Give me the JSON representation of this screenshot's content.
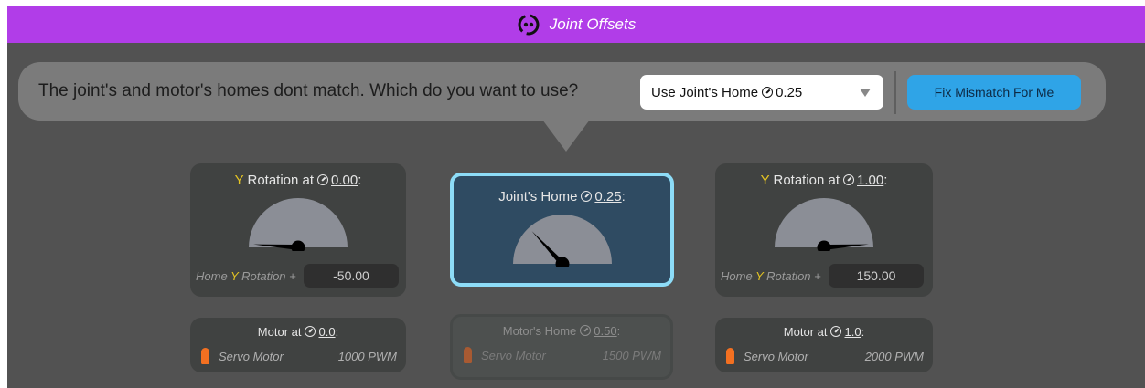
{
  "header": {
    "title": "Joint Offsets",
    "icon": "joint-icon"
  },
  "prompt": {
    "question": "The joint's and motor's homes dont match. Which do you want to use?",
    "select_label": "Use Joint's Home",
    "select_value": "0.25",
    "fix_button": "Fix Mismatch For Me"
  },
  "left": {
    "head_axis": "Y",
    "head_text": " Rotation at",
    "head_value": "0.00",
    "gauge_level": 0.0,
    "offset_label_pre": "Home ",
    "offset_label_axis": "Y",
    "offset_label_post": " Rotation +",
    "offset_value": "-50.00"
  },
  "center": {
    "head_text": "Joint's Home",
    "head_value": "0.25",
    "gauge_level": 0.25
  },
  "right": {
    "head_axis": "Y",
    "head_text": " Rotation at",
    "head_value": "1.00",
    "gauge_level": 1.0,
    "offset_label_pre": "Home ",
    "offset_label_axis": "Y",
    "offset_label_post": " Rotation +",
    "offset_value": "150.00"
  },
  "motors": [
    {
      "head_text": "Motor at",
      "head_value": "0.0",
      "name": "Servo Motor",
      "pwm": "1000 PWM"
    },
    {
      "head_text": "Motor's Home",
      "head_value": "0.50",
      "name": "Servo Motor",
      "pwm": "1500 PWM"
    },
    {
      "head_text": "Motor at",
      "head_value": "1.0",
      "name": "Servo Motor",
      "pwm": "2000 PWM"
    }
  ],
  "colors": {
    "accent": "#b13de8",
    "button": "#2fa4e7",
    "axis_highlight": "#e3c323",
    "selected_border": "#8ddcf7",
    "servo": "#f37021"
  }
}
